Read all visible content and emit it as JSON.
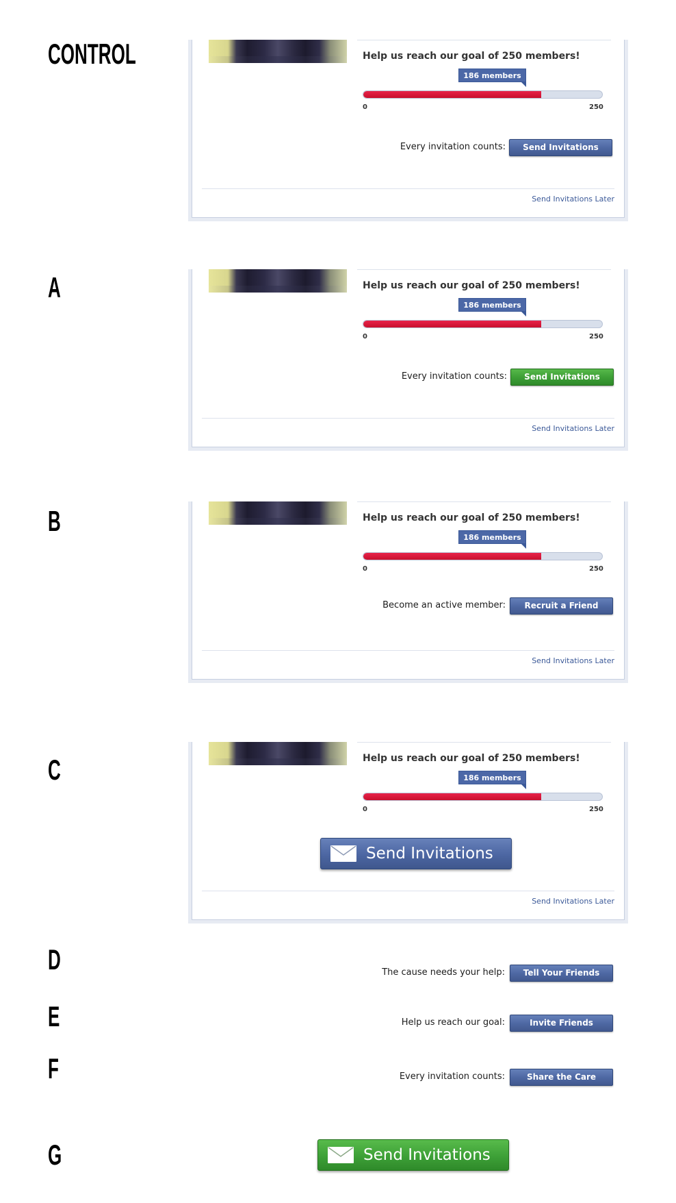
{
  "variants": {
    "control": {
      "label": "CONTROL",
      "goal_text": "Help us reach our goal of 250 members!",
      "members_badge": "186 members",
      "progress_value": 186,
      "progress_max": 250,
      "scale_min": "0",
      "scale_max": "250",
      "cta_text": "Every invitation counts:",
      "button_label": "Send Invitations",
      "button_color": "#4c66a2",
      "later_link": "Send Invitations Later"
    },
    "a": {
      "label": "A",
      "goal_text": "Help us reach our goal of 250 members!",
      "members_badge": "186 members",
      "progress_value": 186,
      "progress_max": 250,
      "scale_min": "0",
      "scale_max": "250",
      "cta_text": "Every invitation counts:",
      "button_label": "Send Invitations",
      "button_color": "#3c9e35",
      "later_link": "Send Invitations Later"
    },
    "b": {
      "label": "B",
      "goal_text": "Help us reach our goal of 250 members!",
      "members_badge": "186 members",
      "progress_value": 186,
      "progress_max": 250,
      "scale_min": "0",
      "scale_max": "250",
      "cta_text": "Become an active member:",
      "button_label": "Recruit a Friend",
      "button_color": "#4c66a2",
      "later_link": "Send Invitations Later"
    },
    "c": {
      "label": "C",
      "goal_text": "Help us reach our goal of 250 members!",
      "members_badge": "186 members",
      "progress_value": 186,
      "progress_max": 250,
      "scale_min": "0",
      "scale_max": "250",
      "button_label": "Send Invitations",
      "button_icon": "envelope-icon",
      "button_color": "#4c66a2",
      "later_link": "Send Invitations Later"
    },
    "d": {
      "label": "D",
      "cta_text": "The cause needs your help:",
      "button_label": "Tell Your Friends",
      "button_color": "#4c66a2"
    },
    "e": {
      "label": "E",
      "cta_text": "Help us reach our goal:",
      "button_label": "Invite Friends",
      "button_color": "#4c66a2"
    },
    "f": {
      "label": "F",
      "cta_text": "Every invitation counts:",
      "button_label": "Share the Care",
      "button_color": "#4c66a2"
    },
    "g": {
      "label": "G",
      "button_label": "Send Invitations",
      "button_icon": "envelope-icon",
      "button_color": "#3c9e35"
    }
  },
  "colors": {
    "progress_fill": "#c8102e",
    "progress_track": "#d8dfeb",
    "link": "#3b5998",
    "badge": "#4c68a7"
  }
}
